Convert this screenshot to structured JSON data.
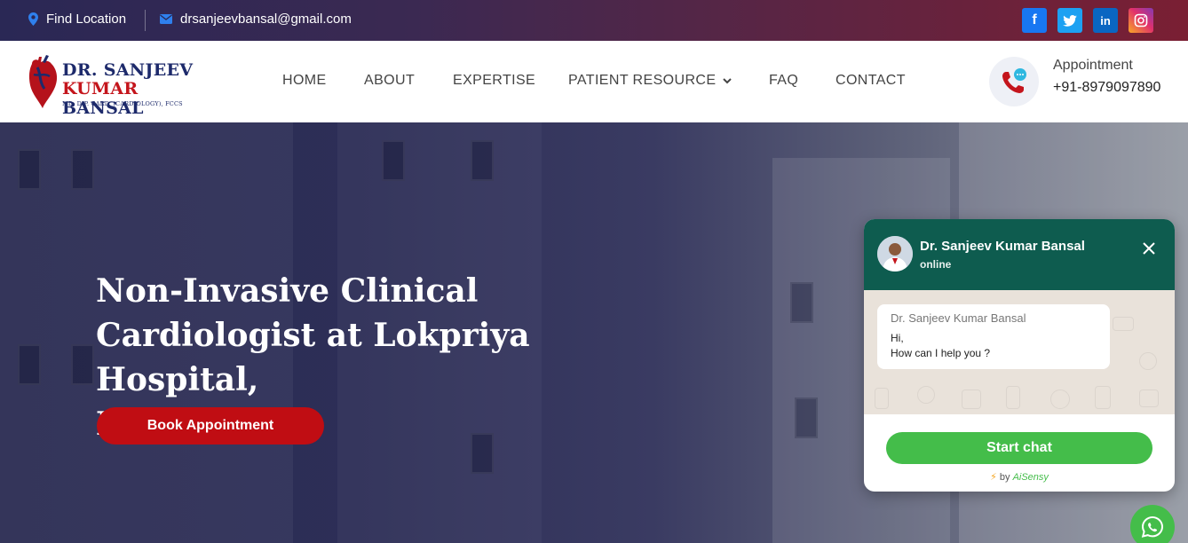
{
  "topbar": {
    "location_label": "Find Location",
    "email": "drsanjeevbansal@gmail.com",
    "social": {
      "facebook": "f",
      "twitter": "twitter-icon",
      "linkedin": "in",
      "instagram": "instagram-icon"
    },
    "colors": {
      "gradient_start": "#2a2855",
      "gradient_end": "#7a1f33"
    }
  },
  "logo": {
    "line1": "DR. SANJEEV",
    "line2_red": "KUMAR",
    "line2_blue": "BANSAL",
    "line3": "MD, DIP. CARD. (CARDIOLOGY), FCCS"
  },
  "nav": {
    "items": [
      "HOME",
      "ABOUT",
      "EXPERTISE",
      "PATIENT RESOURCE",
      "FAQ",
      "CONTACT"
    ]
  },
  "appointment": {
    "label": "Appointment",
    "phone": "+91-8979097890"
  },
  "hero": {
    "title_line1": "Non-Invasive Clinical",
    "title_line2": "Cardiologist at Lokpriya Hospital,",
    "title_line3": "Meerut",
    "button": "Book Appointment",
    "colors": {
      "button": "#c00d13"
    }
  },
  "chat": {
    "name": "Dr. Sanjeev Kumar Bansal",
    "status": "online",
    "bubble_from": "Dr. Sanjeev Kumar Bansal",
    "bubble_line1": "Hi,",
    "bubble_line2": "How can I help you ?",
    "start_button": "Start chat",
    "powered_by": "by",
    "powered_brand": "AiSensy",
    "colors": {
      "header": "#0e5c4f",
      "button": "#44bd4a"
    }
  }
}
